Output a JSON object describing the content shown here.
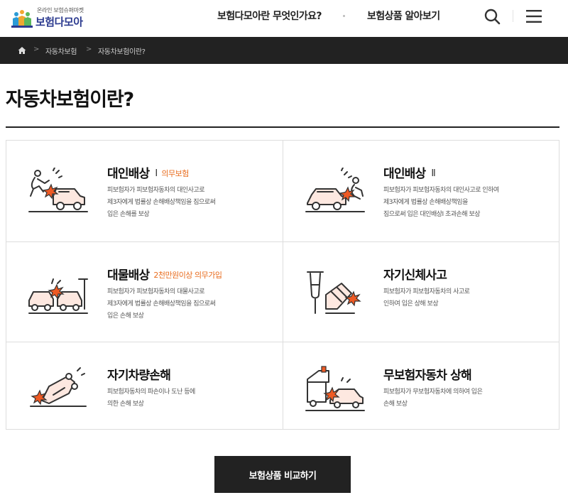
{
  "header": {
    "logo_tagline": "온라인 보험슈퍼마켓",
    "logo_brand": "보험다모아",
    "nav": [
      "보험다모아란 무엇인가요?",
      "보험상품 알아보기"
    ]
  },
  "breadcrumb": {
    "items": [
      "자동차보험",
      "자동차보험이란?"
    ]
  },
  "page": {
    "title": "자동차보험이란?"
  },
  "coverages": [
    {
      "title": "대인배상",
      "marker": "Ⅰ",
      "tag": "의무보험",
      "lines": [
        "피보험자가 피보험자동차의 대인사고로",
        "제3자에게 법률상 손해배상책임을 짐으로써",
        "입은 손해를 보상"
      ]
    },
    {
      "title": "대인배상",
      "marker": "Ⅱ",
      "tag": "",
      "lines": [
        "피보험자가 피보험자동차의 대인사고로 인하여",
        "제3자에게 법률상 손해배상책임을",
        "짐으로써 입은 대인배상Ⅰ 초과손해 보상"
      ]
    },
    {
      "title": "대물배상",
      "marker": "",
      "tag": "2천만원이상 의무가입",
      "lines": [
        "피보험자가 피보험자동차의 대물사고로",
        "제3자에게 법률상 손해배상책임을 짐으로써",
        "입은 손해 보상"
      ]
    },
    {
      "title": "자기신체사고",
      "marker": "",
      "tag": "",
      "lines": [
        "피보험자가 피보험자동차의 사고로",
        "인하여 입은 상해 보상"
      ]
    },
    {
      "title": "자기차량손해",
      "marker": "",
      "tag": "",
      "lines": [
        "피보험자동차의 파손이나 도난 등에",
        "의한 손해 보상"
      ]
    },
    {
      "title": "무보험자동차 상해",
      "marker": "",
      "tag": "",
      "lines": [
        "피보험자가 무보험자동차에 의하여 입은",
        "손해 보상"
      ]
    }
  ],
  "actions": {
    "compare_label": "보험상품 비교하기"
  },
  "colors": {
    "accent": "#e86b1c",
    "dark": "#222222",
    "brand": "#2b3a8f"
  }
}
